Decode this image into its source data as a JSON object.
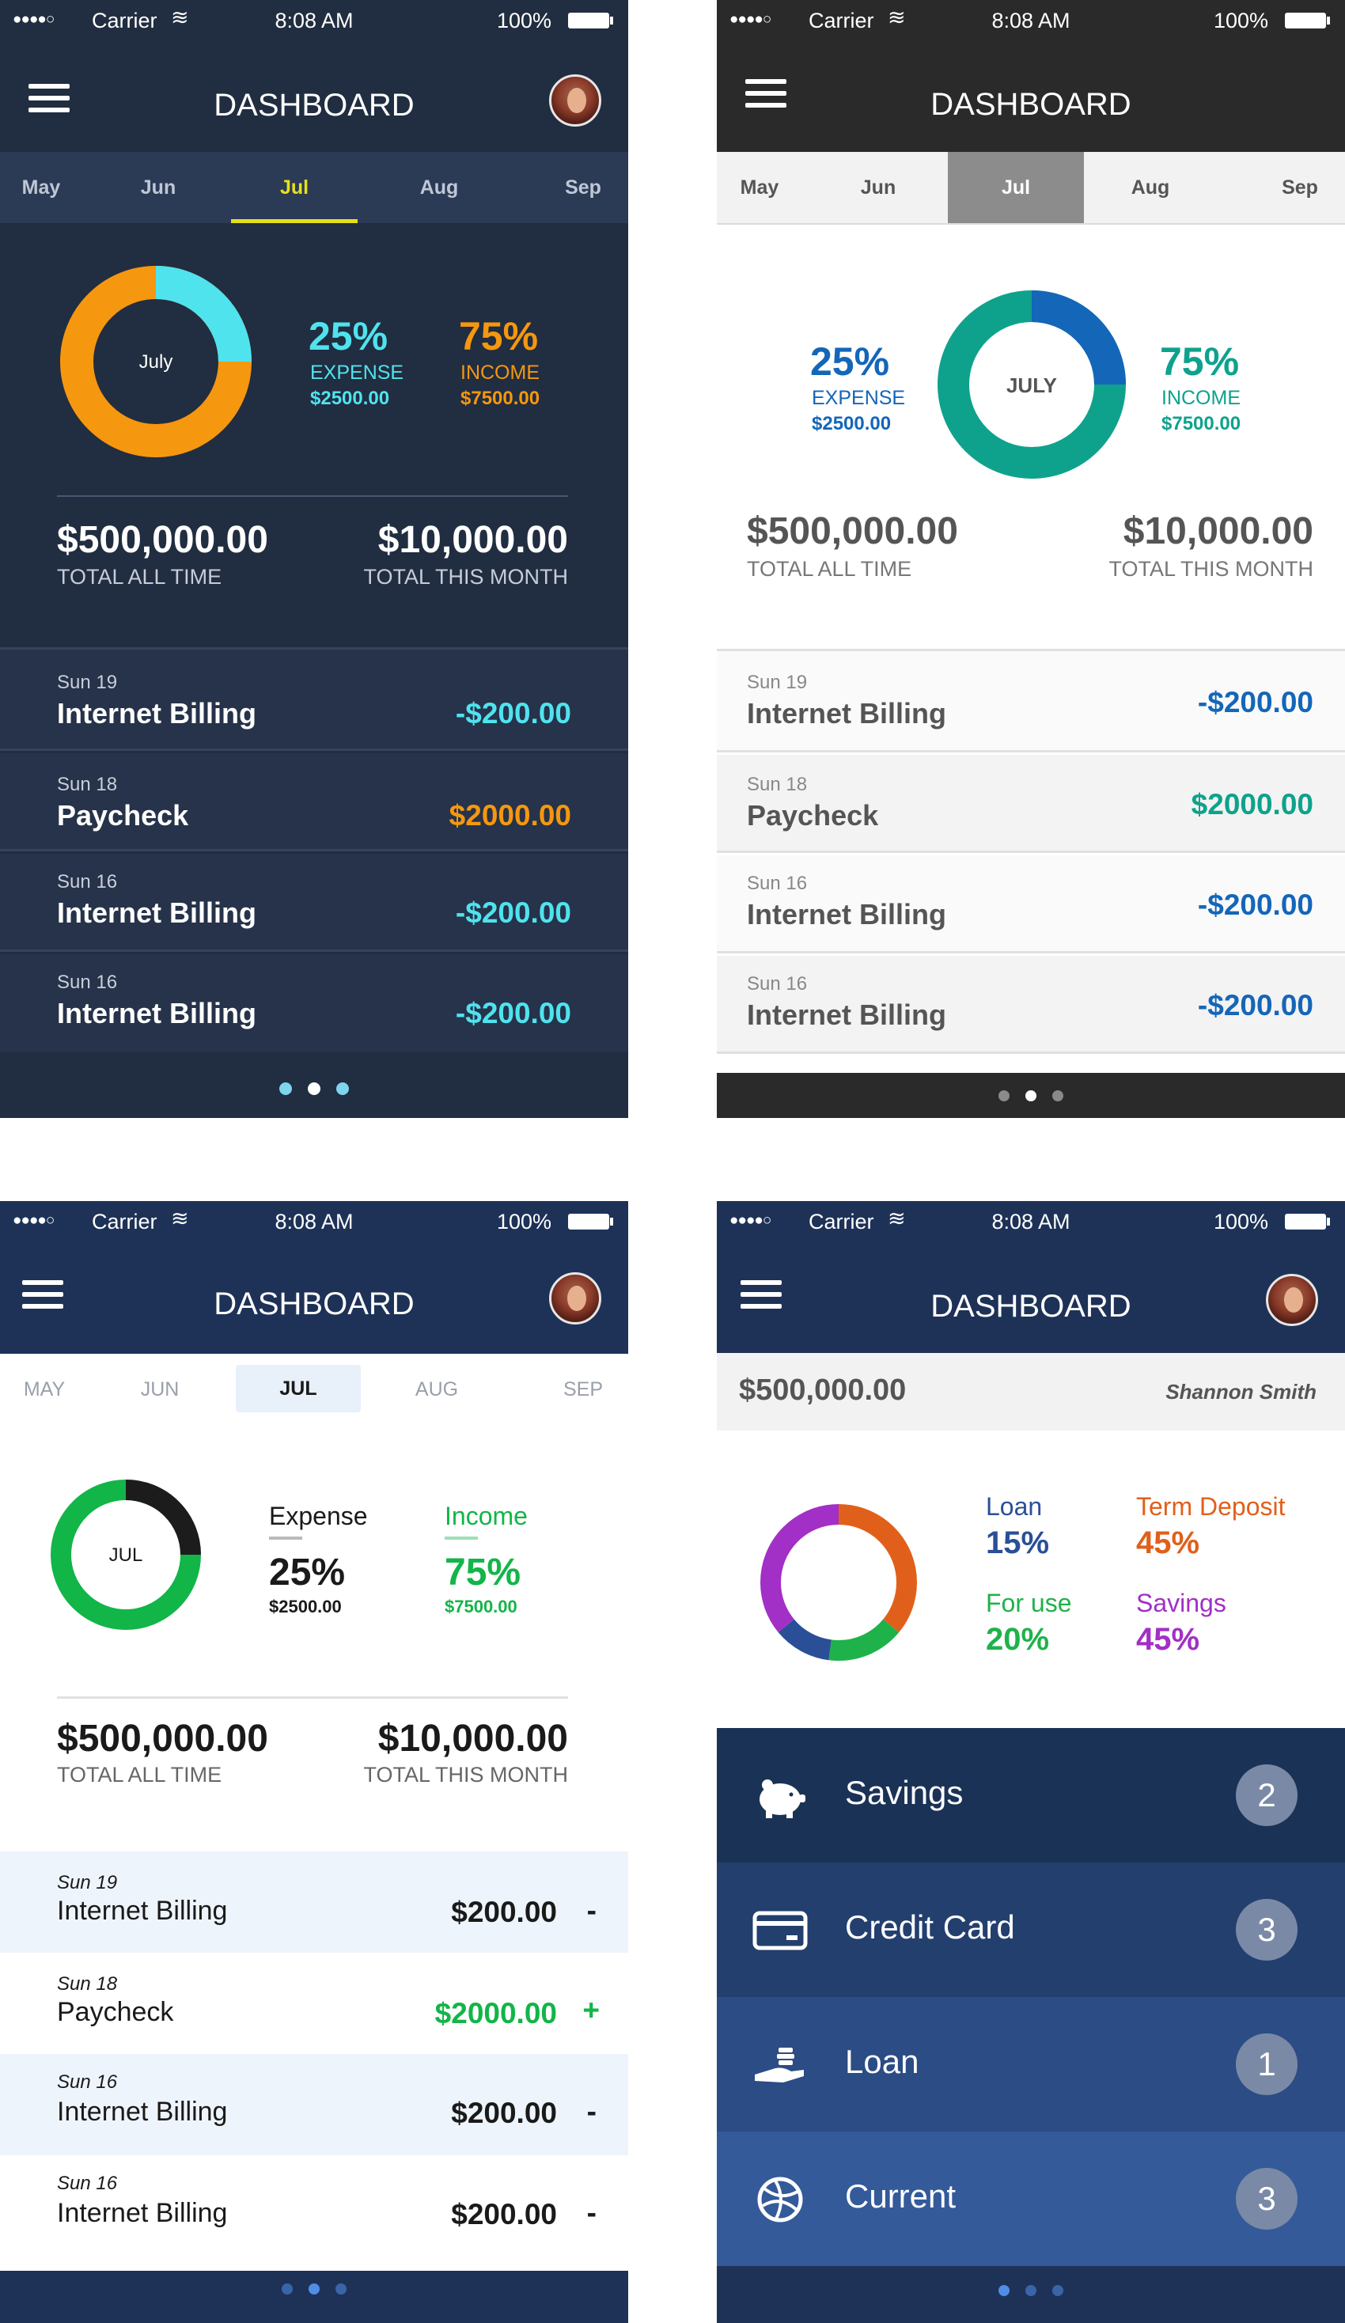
{
  "status": {
    "carrier": "Carrier",
    "time": "8:08 AM",
    "battery": "100%"
  },
  "dashboard_title": "DASHBOARD",
  "months_title": [
    "May",
    "Jun",
    "Jul",
    "Aug",
    "Sep"
  ],
  "months_upper": [
    "MAY",
    "JUN",
    "JUL",
    "AUG",
    "SEP"
  ],
  "selected_month_index": 2,
  "dark": {
    "donut_label": "July",
    "donut_expense_fraction": 0.25,
    "expense": {
      "pct": "25%",
      "label": "EXPENSE",
      "amount": "$2500.00"
    },
    "income": {
      "pct": "75%",
      "label": "INCOME",
      "amount": "$7500.00"
    },
    "total_all": {
      "value": "$500,000.00",
      "label": "TOTAL ALL TIME"
    },
    "total_month": {
      "value": "$10,000.00",
      "label": "TOTAL THIS MONTH"
    },
    "transactions": [
      {
        "date": "Sun 19",
        "name": "Internet Billing",
        "amount": "-$200.00",
        "type": "expense"
      },
      {
        "date": "Sun 18",
        "name": "Paycheck",
        "amount": "$2000.00",
        "type": "income"
      },
      {
        "date": "Sun 16",
        "name": "Internet Billing",
        "amount": "-$200.00",
        "type": "expense"
      },
      {
        "date": "Sun 16",
        "name": "Internet Billing",
        "amount": "-$200.00",
        "type": "expense"
      }
    ],
    "colors": {
      "bg": "#212d40",
      "expense": "#4fe3ee",
      "income": "#f5970f",
      "tab_active": "#e5e01c"
    }
  },
  "light": {
    "donut_label": "JULY",
    "donut_expense_fraction": 0.25,
    "expense": {
      "pct": "25%",
      "label": "EXPENSE",
      "amount": "$2500.00"
    },
    "income": {
      "pct": "75%",
      "label": "INCOME",
      "amount": "$7500.00"
    },
    "total_all": {
      "value": "$500,000.00",
      "label": "TOTAL ALL TIME"
    },
    "total_month": {
      "value": "$10,000.00",
      "label": "TOTAL THIS MONTH"
    },
    "transactions": [
      {
        "date": "Sun 19",
        "name": "Internet Billing",
        "amount": "-$200.00",
        "type": "expense"
      },
      {
        "date": "Sun 18",
        "name": "Paycheck",
        "amount": "$2000.00",
        "type": "income"
      },
      {
        "date": "Sun 16",
        "name": "Internet Billing",
        "amount": "-$200.00",
        "type": "expense"
      },
      {
        "date": "Sun 16",
        "name": "Internet Billing",
        "amount": "-$200.00",
        "type": "expense"
      }
    ],
    "colors": {
      "expense": "#1466b8",
      "income": "#0ea28c",
      "header": "#2a2a2a"
    }
  },
  "minimal": {
    "donut_label": "JUL",
    "donut_expense_fraction": 0.25,
    "expense": {
      "label": "Expense",
      "pct": "25%",
      "amount": "$2500.00"
    },
    "income": {
      "label": "Income",
      "pct": "75%",
      "amount": "$7500.00"
    },
    "total_all": {
      "value": "$500,000.00",
      "label": "TOTAL ALL TIME"
    },
    "total_month": {
      "value": "$10,000.00",
      "label": "TOTAL THIS MONTH"
    },
    "transactions": [
      {
        "date": "Sun 19",
        "name": "Internet Billing",
        "amount": "$200.00",
        "sign": "-",
        "type": "expense"
      },
      {
        "date": "Sun 18",
        "name": "Paycheck",
        "amount": "$2000.00",
        "sign": "+",
        "type": "income"
      },
      {
        "date": "Sun 16",
        "name": "Internet Billing",
        "amount": "$200.00",
        "sign": "-",
        "type": "expense"
      },
      {
        "date": "Sun 16",
        "name": "Internet Billing",
        "amount": "$200.00",
        "sign": "-",
        "type": "expense"
      }
    ],
    "colors": {
      "header": "#1e3257",
      "income": "#12b548",
      "expense_ring": "#1c1c1c"
    }
  },
  "accounts": {
    "balance": "$500,000.00",
    "user": "Shannon Smith",
    "breakdown": [
      {
        "label": "Loan",
        "pct": "15%",
        "value": 15,
        "color": "#2b4f97"
      },
      {
        "label": "Term Deposit",
        "pct": "45%",
        "value": 45,
        "color": "#e0601b"
      },
      {
        "label": "For use",
        "pct": "20%",
        "value": 20,
        "color": "#1fb24a"
      },
      {
        "label": "Savings",
        "pct": "45%",
        "value": 45,
        "color": "#a22fc6"
      }
    ],
    "categories": [
      {
        "label": "Savings",
        "count": "2",
        "icon": "piggy-bank-icon",
        "bg": "#1b3257"
      },
      {
        "label": "Credit Card",
        "count": "3",
        "icon": "credit-card-icon",
        "bg": "#233f6e"
      },
      {
        "label": "Loan",
        "count": "1",
        "icon": "hand-coins-icon",
        "bg": "#2b4c84"
      },
      {
        "label": "Current",
        "count": "3",
        "icon": "globe-icon",
        "bg": "#345a99"
      }
    ]
  },
  "page_dots": [
    false,
    true,
    false
  ]
}
